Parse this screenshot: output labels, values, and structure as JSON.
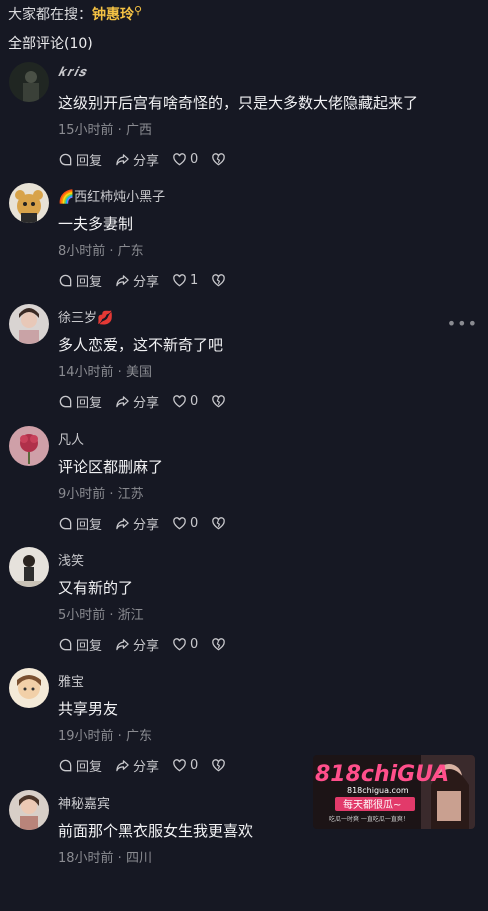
{
  "search_hint": {
    "prefix": "大家都在搜：",
    "keyword": "钟惠玲"
  },
  "comments_header": "全部评论(10)",
  "comments": [
    {
      "user": "𝒌𝒓𝒊𝒔",
      "text": "这级别开后宫有啥奇怪的，只是大多数大佬隐藏起来了",
      "time": "15小时前 · 广西",
      "likes": "0",
      "reply": "回复",
      "share": "分享"
    },
    {
      "user": "🌈西红柿炖小黑子",
      "text": "一夫多妻制",
      "time": "8小时前 · 广东",
      "likes": "1",
      "reply": "回复",
      "share": "分享"
    },
    {
      "user": "徐三岁💋",
      "text": "多人恋爱，这不新奇了吧",
      "time": "14小时前 · 美国",
      "likes": "0",
      "reply": "回复",
      "share": "分享"
    },
    {
      "user": "凡人",
      "text": "评论区都删麻了",
      "time": "9小时前 · 江苏",
      "likes": "0",
      "reply": "回复",
      "share": "分享"
    },
    {
      "user": "浅笑",
      "text": "又有新的了",
      "time": "5小时前 · 浙江",
      "likes": "0",
      "reply": "回复",
      "share": "分享"
    },
    {
      "user": "雅宝",
      "text": "共享男友",
      "time": "19小时前 · 广东",
      "likes": "0",
      "reply": "回复",
      "share": "分享"
    },
    {
      "user": "神秘嘉宾",
      "text": "前面那个黑衣服女生我更喜欢",
      "time": "18小时前 · 四川",
      "likes": "",
      "reply": "",
      "share": ""
    }
  ],
  "ad": {
    "brand": "818chiGUA",
    "domain": "818chigua.com",
    "slogan": "每天都很瓜~",
    "tagline": "吃瓜一时爽 一直吃瓜一直爽！"
  },
  "colors": {
    "background": "#161823",
    "keyword": "#f5c244",
    "meta": "#8a8b91"
  }
}
